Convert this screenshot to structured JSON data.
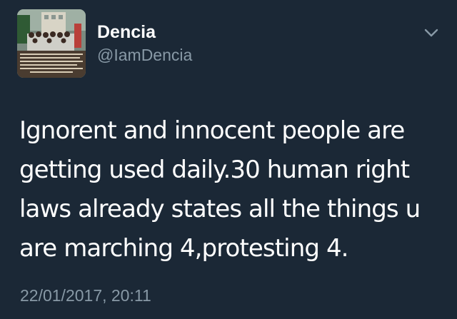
{
  "tweet": {
    "author": {
      "display_name": "Dencia",
      "handle": "@IamDencia",
      "avatar_icon": "profile-photo-group-with-caption"
    },
    "menu_icon": "chevron-down-icon",
    "text_lines": [
      "Ignorent and innocent people are",
      "getting used daily.30 human right",
      "laws already states all the things u",
      "are marching 4,protesting 4."
    ],
    "timestamp": "22/01/2017, 20:11"
  },
  "colors": {
    "background": "#1b2836",
    "text_primary": "#ffffff",
    "text_secondary": "#8899a6"
  }
}
